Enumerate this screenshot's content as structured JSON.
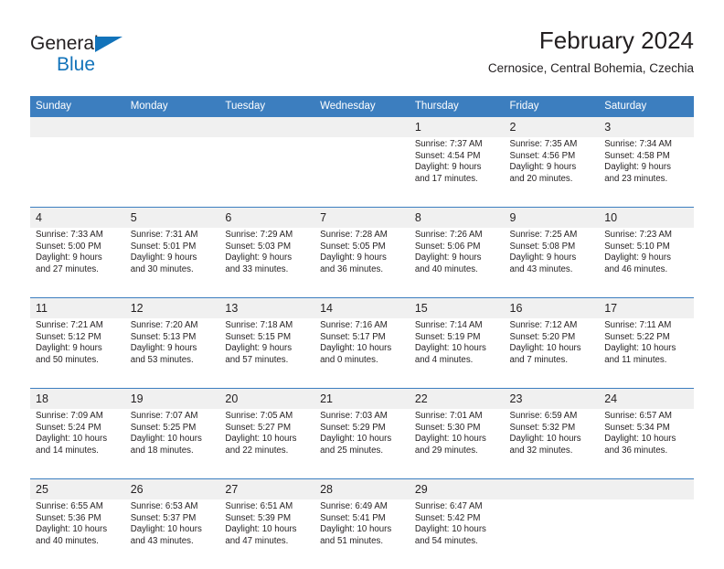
{
  "brand": {
    "name_part1": "General",
    "name_part2": "Blue",
    "logo_icon": "triangle-logo-icon",
    "colors": {
      "blue": "#1273ba",
      "dark": "#231f20"
    }
  },
  "header": {
    "title": "February 2024",
    "subtitle": "Cernosice, Central Bohemia, Czechia"
  },
  "calendar": {
    "accent_color": "#3c7ebf",
    "daynum_band_color": "#f0f0f0",
    "weekday_headers": [
      "Sunday",
      "Monday",
      "Tuesday",
      "Wednesday",
      "Thursday",
      "Friday",
      "Saturday"
    ],
    "weeks": [
      [
        {
          "day": "",
          "sunrise": "",
          "sunset": "",
          "daylight_line1": "",
          "daylight_line2": ""
        },
        {
          "day": "",
          "sunrise": "",
          "sunset": "",
          "daylight_line1": "",
          "daylight_line2": ""
        },
        {
          "day": "",
          "sunrise": "",
          "sunset": "",
          "daylight_line1": "",
          "daylight_line2": ""
        },
        {
          "day": "",
          "sunrise": "",
          "sunset": "",
          "daylight_line1": "",
          "daylight_line2": ""
        },
        {
          "day": "1",
          "sunrise": "Sunrise: 7:37 AM",
          "sunset": "Sunset: 4:54 PM",
          "daylight_line1": "Daylight: 9 hours",
          "daylight_line2": "and 17 minutes."
        },
        {
          "day": "2",
          "sunrise": "Sunrise: 7:35 AM",
          "sunset": "Sunset: 4:56 PM",
          "daylight_line1": "Daylight: 9 hours",
          "daylight_line2": "and 20 minutes."
        },
        {
          "day": "3",
          "sunrise": "Sunrise: 7:34 AM",
          "sunset": "Sunset: 4:58 PM",
          "daylight_line1": "Daylight: 9 hours",
          "daylight_line2": "and 23 minutes."
        }
      ],
      [
        {
          "day": "4",
          "sunrise": "Sunrise: 7:33 AM",
          "sunset": "Sunset: 5:00 PM",
          "daylight_line1": "Daylight: 9 hours",
          "daylight_line2": "and 27 minutes."
        },
        {
          "day": "5",
          "sunrise": "Sunrise: 7:31 AM",
          "sunset": "Sunset: 5:01 PM",
          "daylight_line1": "Daylight: 9 hours",
          "daylight_line2": "and 30 minutes."
        },
        {
          "day": "6",
          "sunrise": "Sunrise: 7:29 AM",
          "sunset": "Sunset: 5:03 PM",
          "daylight_line1": "Daylight: 9 hours",
          "daylight_line2": "and 33 minutes."
        },
        {
          "day": "7",
          "sunrise": "Sunrise: 7:28 AM",
          "sunset": "Sunset: 5:05 PM",
          "daylight_line1": "Daylight: 9 hours",
          "daylight_line2": "and 36 minutes."
        },
        {
          "day": "8",
          "sunrise": "Sunrise: 7:26 AM",
          "sunset": "Sunset: 5:06 PM",
          "daylight_line1": "Daylight: 9 hours",
          "daylight_line2": "and 40 minutes."
        },
        {
          "day": "9",
          "sunrise": "Sunrise: 7:25 AM",
          "sunset": "Sunset: 5:08 PM",
          "daylight_line1": "Daylight: 9 hours",
          "daylight_line2": "and 43 minutes."
        },
        {
          "day": "10",
          "sunrise": "Sunrise: 7:23 AM",
          "sunset": "Sunset: 5:10 PM",
          "daylight_line1": "Daylight: 9 hours",
          "daylight_line2": "and 46 minutes."
        }
      ],
      [
        {
          "day": "11",
          "sunrise": "Sunrise: 7:21 AM",
          "sunset": "Sunset: 5:12 PM",
          "daylight_line1": "Daylight: 9 hours",
          "daylight_line2": "and 50 minutes."
        },
        {
          "day": "12",
          "sunrise": "Sunrise: 7:20 AM",
          "sunset": "Sunset: 5:13 PM",
          "daylight_line1": "Daylight: 9 hours",
          "daylight_line2": "and 53 minutes."
        },
        {
          "day": "13",
          "sunrise": "Sunrise: 7:18 AM",
          "sunset": "Sunset: 5:15 PM",
          "daylight_line1": "Daylight: 9 hours",
          "daylight_line2": "and 57 minutes."
        },
        {
          "day": "14",
          "sunrise": "Sunrise: 7:16 AM",
          "sunset": "Sunset: 5:17 PM",
          "daylight_line1": "Daylight: 10 hours",
          "daylight_line2": "and 0 minutes."
        },
        {
          "day": "15",
          "sunrise": "Sunrise: 7:14 AM",
          "sunset": "Sunset: 5:19 PM",
          "daylight_line1": "Daylight: 10 hours",
          "daylight_line2": "and 4 minutes."
        },
        {
          "day": "16",
          "sunrise": "Sunrise: 7:12 AM",
          "sunset": "Sunset: 5:20 PM",
          "daylight_line1": "Daylight: 10 hours",
          "daylight_line2": "and 7 minutes."
        },
        {
          "day": "17",
          "sunrise": "Sunrise: 7:11 AM",
          "sunset": "Sunset: 5:22 PM",
          "daylight_line1": "Daylight: 10 hours",
          "daylight_line2": "and 11 minutes."
        }
      ],
      [
        {
          "day": "18",
          "sunrise": "Sunrise: 7:09 AM",
          "sunset": "Sunset: 5:24 PM",
          "daylight_line1": "Daylight: 10 hours",
          "daylight_line2": "and 14 minutes."
        },
        {
          "day": "19",
          "sunrise": "Sunrise: 7:07 AM",
          "sunset": "Sunset: 5:25 PM",
          "daylight_line1": "Daylight: 10 hours",
          "daylight_line2": "and 18 minutes."
        },
        {
          "day": "20",
          "sunrise": "Sunrise: 7:05 AM",
          "sunset": "Sunset: 5:27 PM",
          "daylight_line1": "Daylight: 10 hours",
          "daylight_line2": "and 22 minutes."
        },
        {
          "day": "21",
          "sunrise": "Sunrise: 7:03 AM",
          "sunset": "Sunset: 5:29 PM",
          "daylight_line1": "Daylight: 10 hours",
          "daylight_line2": "and 25 minutes."
        },
        {
          "day": "22",
          "sunrise": "Sunrise: 7:01 AM",
          "sunset": "Sunset: 5:30 PM",
          "daylight_line1": "Daylight: 10 hours",
          "daylight_line2": "and 29 minutes."
        },
        {
          "day": "23",
          "sunrise": "Sunrise: 6:59 AM",
          "sunset": "Sunset: 5:32 PM",
          "daylight_line1": "Daylight: 10 hours",
          "daylight_line2": "and 32 minutes."
        },
        {
          "day": "24",
          "sunrise": "Sunrise: 6:57 AM",
          "sunset": "Sunset: 5:34 PM",
          "daylight_line1": "Daylight: 10 hours",
          "daylight_line2": "and 36 minutes."
        }
      ],
      [
        {
          "day": "25",
          "sunrise": "Sunrise: 6:55 AM",
          "sunset": "Sunset: 5:36 PM",
          "daylight_line1": "Daylight: 10 hours",
          "daylight_line2": "and 40 minutes."
        },
        {
          "day": "26",
          "sunrise": "Sunrise: 6:53 AM",
          "sunset": "Sunset: 5:37 PM",
          "daylight_line1": "Daylight: 10 hours",
          "daylight_line2": "and 43 minutes."
        },
        {
          "day": "27",
          "sunrise": "Sunrise: 6:51 AM",
          "sunset": "Sunset: 5:39 PM",
          "daylight_line1": "Daylight: 10 hours",
          "daylight_line2": "and 47 minutes."
        },
        {
          "day": "28",
          "sunrise": "Sunrise: 6:49 AM",
          "sunset": "Sunset: 5:41 PM",
          "daylight_line1": "Daylight: 10 hours",
          "daylight_line2": "and 51 minutes."
        },
        {
          "day": "29",
          "sunrise": "Sunrise: 6:47 AM",
          "sunset": "Sunset: 5:42 PM",
          "daylight_line1": "Daylight: 10 hours",
          "daylight_line2": "and 54 minutes."
        },
        {
          "day": "",
          "sunrise": "",
          "sunset": "",
          "daylight_line1": "",
          "daylight_line2": ""
        },
        {
          "day": "",
          "sunrise": "",
          "sunset": "",
          "daylight_line1": "",
          "daylight_line2": ""
        }
      ]
    ]
  }
}
